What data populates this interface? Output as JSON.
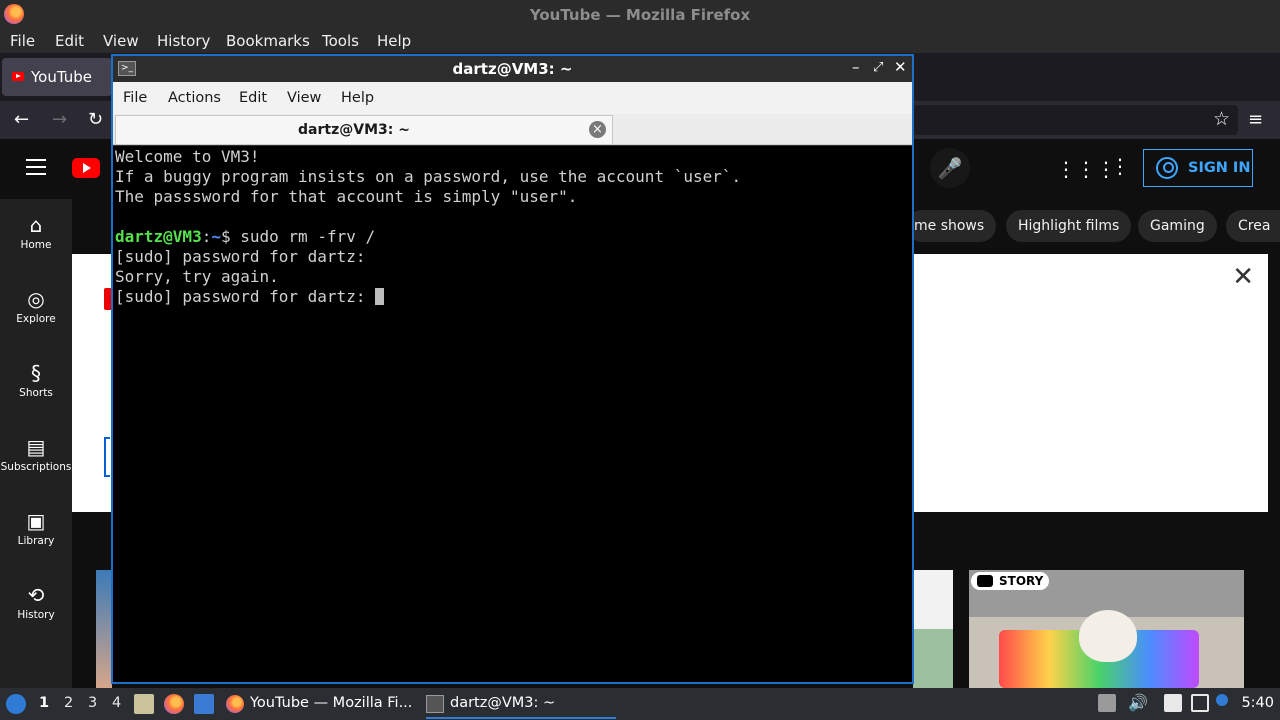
{
  "firefox": {
    "window_title": "YouTube — Mozilla Firefox",
    "menu": [
      "File",
      "Edit",
      "View",
      "History",
      "Bookmarks",
      "Tools",
      "Help"
    ],
    "tab_label": "YouTube"
  },
  "youtube": {
    "sign_in_label": "SIGN IN",
    "guide": [
      {
        "label": "Home",
        "icon": "home-icon"
      },
      {
        "label": "Explore",
        "icon": "compass-icon"
      },
      {
        "label": "Shorts",
        "icon": "shorts-icon"
      },
      {
        "label": "Subscriptions",
        "icon": "subscriptions-icon"
      },
      {
        "label": "Library",
        "icon": "library-icon"
      },
      {
        "label": "History",
        "icon": "history-icon"
      }
    ],
    "chips": [
      "me shows",
      "Highlight films",
      "Gaming",
      "Crea"
    ],
    "story_badge": "STORY",
    "accent": "#3ea6ff",
    "brand": "#ff0000"
  },
  "terminal": {
    "window_title": "dartz@VM3: ~",
    "menu": [
      "File",
      "Actions",
      "Edit",
      "View",
      "Help"
    ],
    "tab_label": "dartz@VM3: ~",
    "lines": [
      "Welcome to VM3!",
      "If a buggy program insists on a password, use the account `user`.",
      "The passsword for that account is simply \"user\".",
      ""
    ],
    "prompt_user": "dartz@VM3",
    "prompt_sep": ":",
    "prompt_path": "~",
    "prompt_cmd": "$ sudo rm -frv /",
    "output": [
      "[sudo] password for dartz:",
      "Sorry, try again."
    ],
    "current_line": "[sudo] password for dartz: ",
    "prompt_user_color": "#55e04e",
    "prompt_path_color": "#5a8dff"
  },
  "taskbar": {
    "workspaces": [
      "1",
      "2",
      "3",
      "4"
    ],
    "active_workspace": "1",
    "tasks": [
      {
        "label": "YouTube — Mozilla Fi...",
        "icon": "firefox-icon"
      },
      {
        "label": "dartz@VM3: ~",
        "icon": "terminal-icon"
      }
    ],
    "clock": "5:40"
  }
}
